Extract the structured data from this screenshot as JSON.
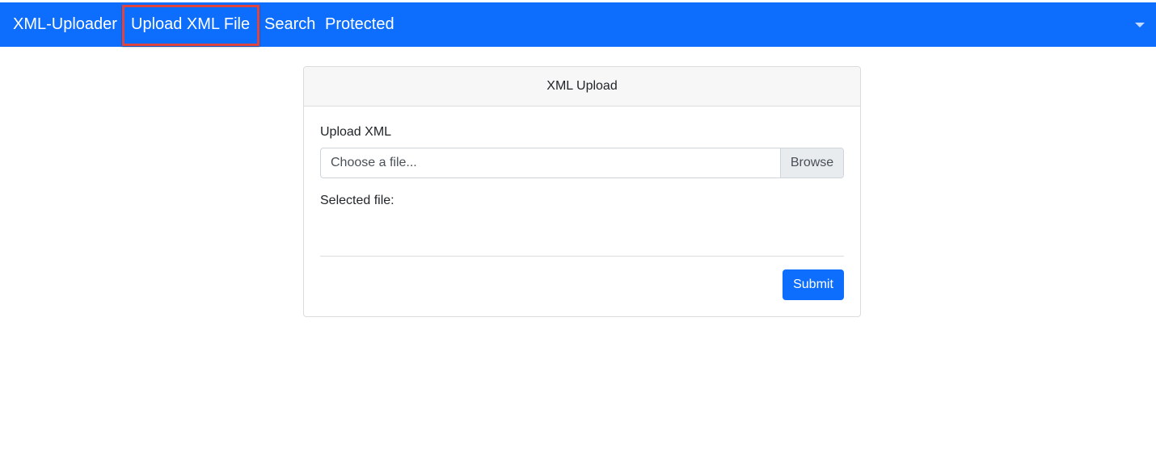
{
  "navbar": {
    "brand": "XML-Uploader",
    "links": [
      "Upload XML File",
      "Search",
      "Protected"
    ],
    "active_link": "Upload XML File",
    "toggle_icon": "caret-down-icon",
    "color": "#0d6efd",
    "highlight_color": "#e0443e"
  },
  "card": {
    "header": "XML Upload",
    "upload_label": "Upload XML",
    "file_placeholder": "Choose a file...",
    "browse_label": "Browse",
    "selected_file_label": "Selected file:",
    "selected_file_value": "",
    "submit_label": "Submit"
  }
}
